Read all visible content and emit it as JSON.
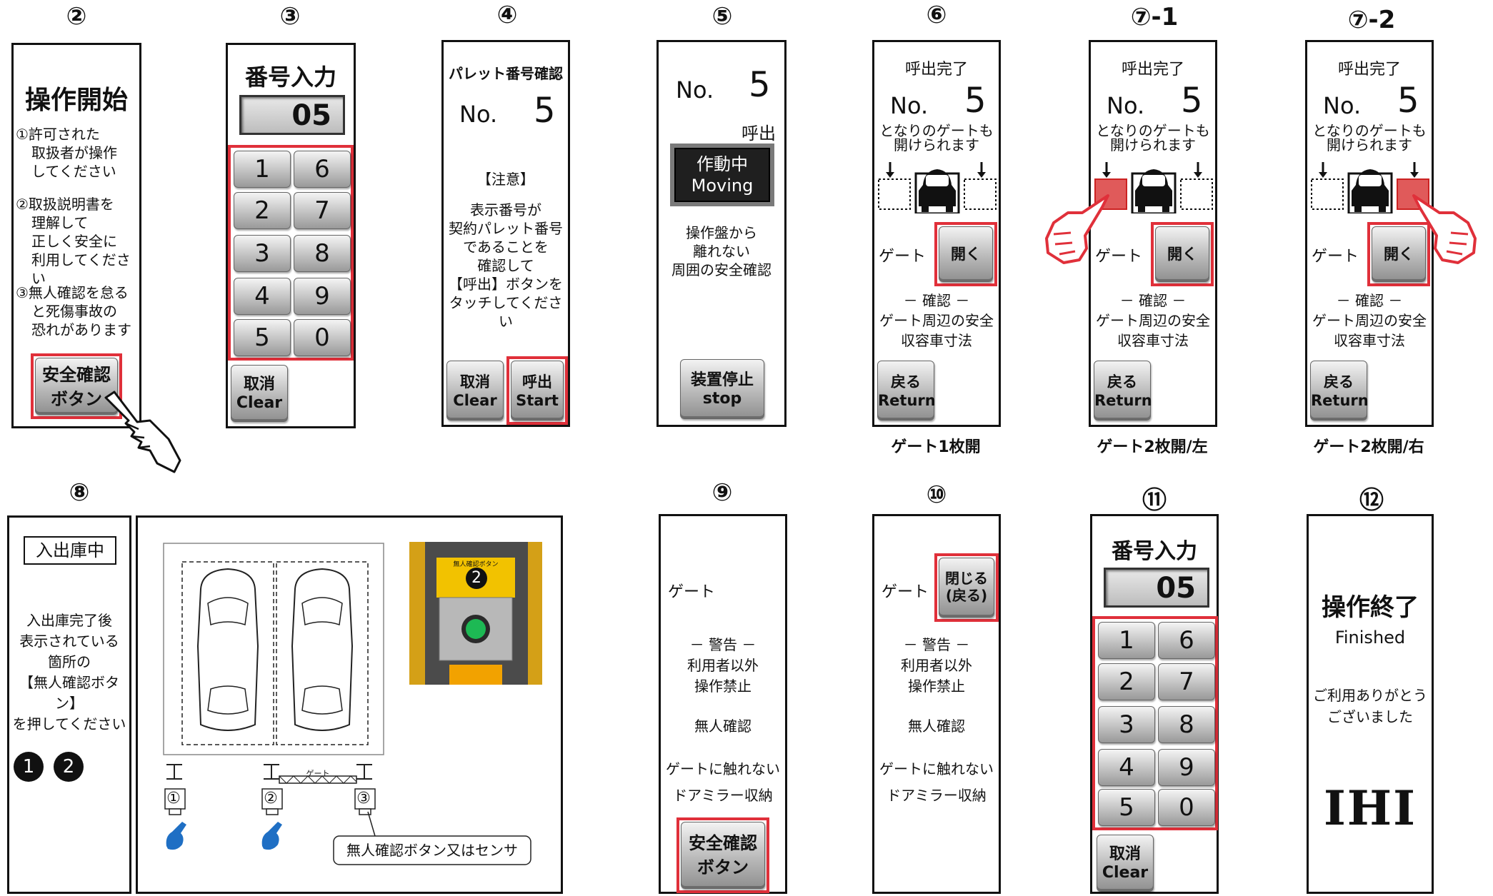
{
  "titles": {
    "p2": "②",
    "p3": "③",
    "p4": "④",
    "p5": "⑤",
    "p6": "⑥",
    "p7a": "⑦-1",
    "p7b": "⑦-2",
    "p8": "⑧",
    "p9": "⑨",
    "p10": "⑩",
    "p11": "⑪",
    "p12": "⑫"
  },
  "p2": {
    "heading": "操作開始",
    "i1a": "①許可された",
    "i1b": "取扱者が操作",
    "i1c": "してください",
    "i2a": "②取扱説明書を",
    "i2b": "理解して",
    "i2c": "正しく安全に",
    "i2d": "利用してください",
    "i3a": "③無人確認を怠る",
    "i3b": "と死傷事故の",
    "i3c": "恐れがあります",
    "btn1": "安全確認",
    "btn2": "ボタン"
  },
  "p3": {
    "heading": "番号入力",
    "value": "05",
    "keys": [
      "1",
      "6",
      "2",
      "7",
      "3",
      "8",
      "4",
      "9",
      "5",
      "0"
    ],
    "clear1": "取消",
    "clear2": "Clear"
  },
  "p4": {
    "heading": "パレット番号確認",
    "no": "No.",
    "num": "5",
    "note": "【注意】",
    "l1": "表示番号が",
    "l2": "契約パレット番号",
    "l3": "であることを",
    "l4": "確認して",
    "l5": "【呼出】ボタンを",
    "l6": "タッチしてください",
    "clear1": "取消",
    "clear2": "Clear",
    "start1": "呼出",
    "start2": "Start"
  },
  "p5": {
    "no": "No.",
    "num": "5",
    "call": "呼出",
    "moving1": "作動中",
    "moving2": "Moving",
    "l1": "操作盤から",
    "l2": "離れない",
    "l3": "周囲の安全確認",
    "stop1": "装置停止",
    "stop2": "stop"
  },
  "gate": {
    "done": "呼出完了",
    "no": "No.",
    "num": "5",
    "l1": "となりのゲートも",
    "l2": "開けられます",
    "gate": "ゲート",
    "open": "開く",
    "confirm": "－ 確認 －",
    "c1": "ゲート周辺の安全",
    "c2": "収容車寸法",
    "back1": "戻る",
    "back2": "Return"
  },
  "captions": {
    "c6": "ゲート1枚開",
    "c7a": "ゲート2枚開/左",
    "c7b": "ゲート2枚開/右"
  },
  "p8": {
    "badge": "入出庫中",
    "l1": "入出庫完了後",
    "l2": "表示されている",
    "l3": "箇所の",
    "l4": "【無人確認ボタン】",
    "l5": "を押してください",
    "n1": "1",
    "n2": "2",
    "m1": "①",
    "m2": "②",
    "m3": "③",
    "gatelabel": "ゲート",
    "callout": "無人確認ボタン又はセンサ",
    "photo_label": "無人確認ボタン",
    "photo_num": "2"
  },
  "p9": {
    "gate": "ゲート",
    "warn": "－ 警告 －",
    "w1": "利用者以外",
    "w2": "操作禁止",
    "w3": "無人確認",
    "w4": "ゲートに触れない",
    "w5": "ドアミラー収納",
    "btn1": "安全確認",
    "btn2": "ボタン"
  },
  "p10": {
    "gate": "ゲート",
    "close1": "閉じる",
    "close2": "(戻る)",
    "warn": "－ 警告 －",
    "w1": "利用者以外",
    "w2": "操作禁止",
    "w3": "無人確認",
    "w4": "ゲートに触れない",
    "w5": "ドアミラー収納"
  },
  "p11": {
    "heading": "番号入力",
    "value": "05",
    "keys": [
      "1",
      "6",
      "2",
      "7",
      "3",
      "8",
      "4",
      "9",
      "5",
      "0"
    ],
    "clear1": "取消",
    "clear2": "Clear"
  },
  "p12": {
    "heading": "操作終了",
    "en": "Finished",
    "l1": "ご利用ありがとう",
    "l2": "ございました",
    "logo": "IHI"
  },
  "colors": {
    "highlight": "#e0303a",
    "hand_blue": "#1f6fc4",
    "button_green": "#1db954"
  }
}
